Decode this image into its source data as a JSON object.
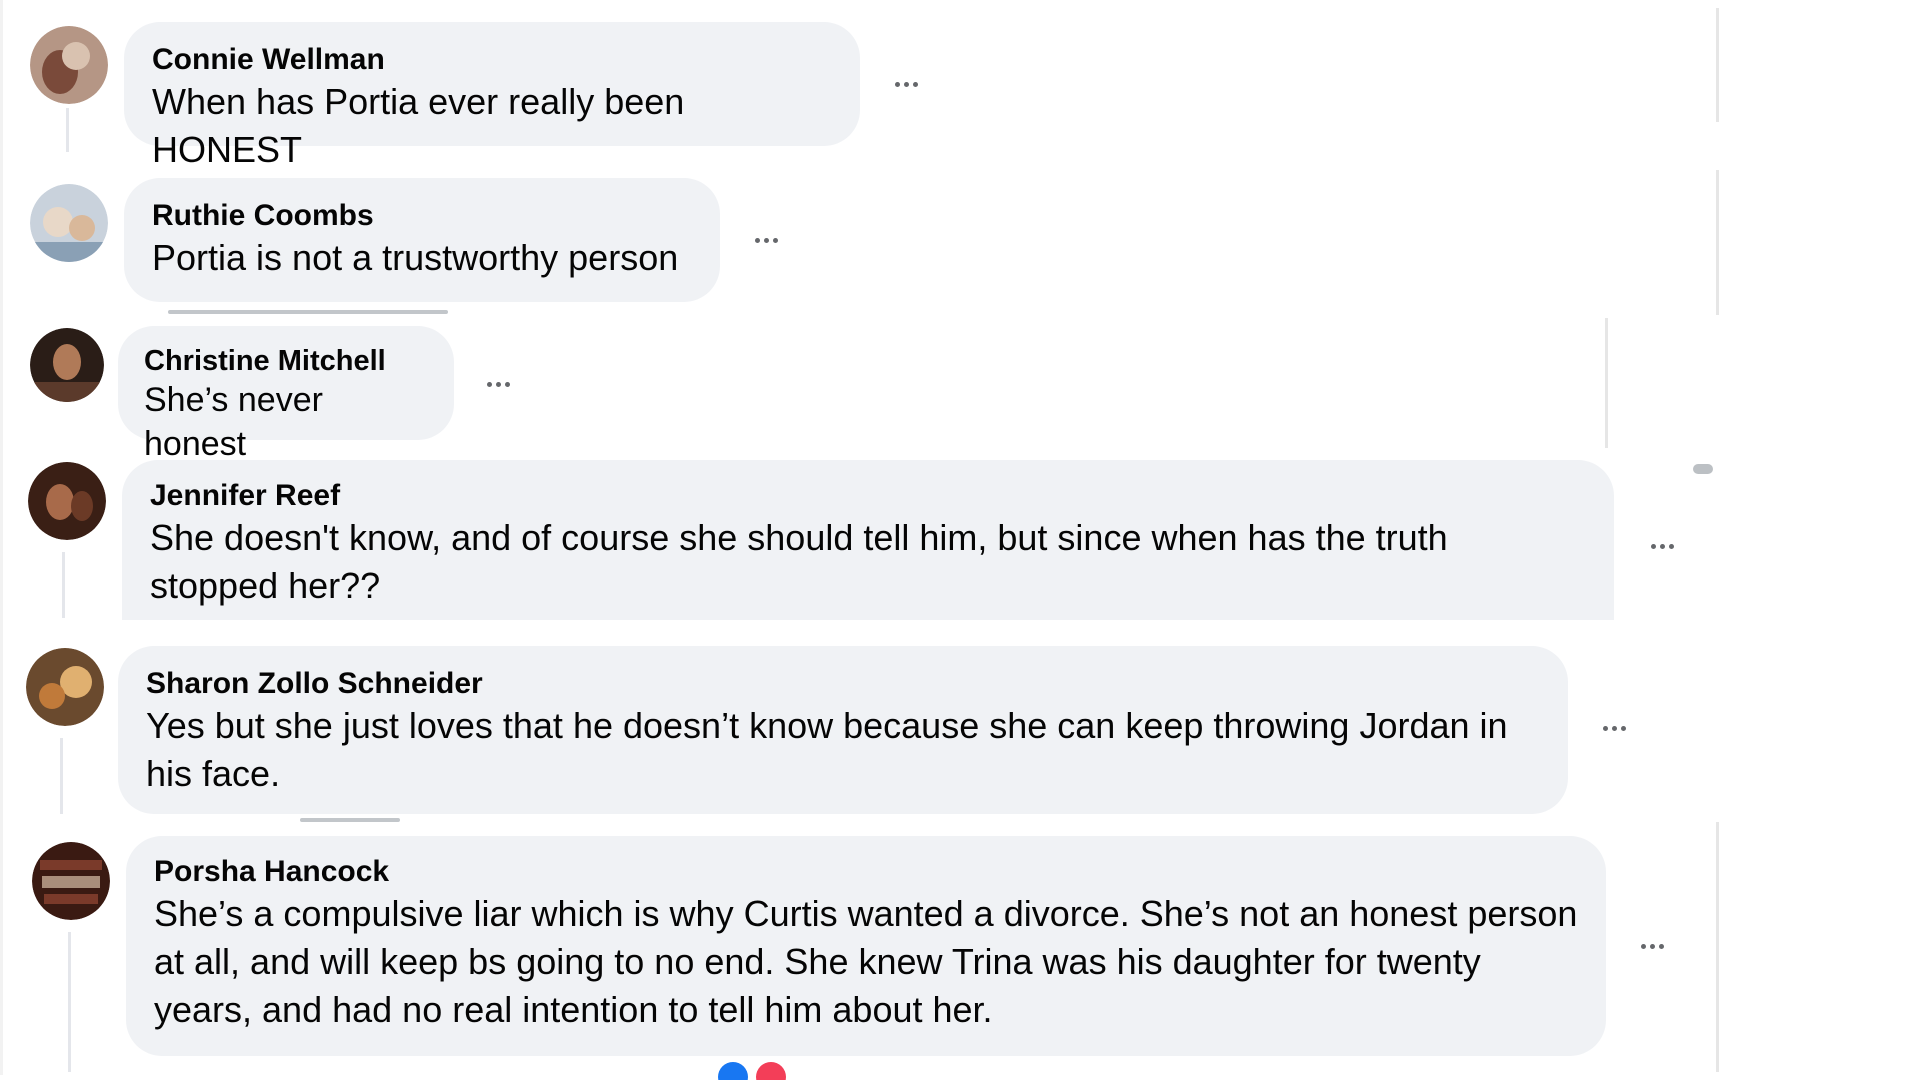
{
  "comments": [
    {
      "author": "Connie Wellman",
      "text": "When has Portia ever really been HONEST",
      "avatar_colors": [
        "#b59685",
        "#7a4a3a",
        "#d9c2b0"
      ]
    },
    {
      "author": "Ruthie Coombs",
      "text": "Portia is not a trustworthy person",
      "avatar_colors": [
        "#c9d2dc",
        "#8aa0b5",
        "#e8d8c8"
      ]
    },
    {
      "author": "Christine Mitchell",
      "text": "She’s never honest",
      "avatar_colors": [
        "#2a1d17",
        "#5b3a2b",
        "#b07a58"
      ]
    },
    {
      "author": "Jennifer Reef",
      "text": "She doesn't know, and of course she should tell him, but since when has the truth stopped her??",
      "avatar_colors": [
        "#3a1f15",
        "#6b3a26",
        "#a86a4a"
      ]
    },
    {
      "author": "Sharon Zollo Schneider",
      "text": "Yes but she just loves that he doesn’t know because she can keep throwing Jordan in his face.",
      "avatar_colors": [
        "#6a4a2e",
        "#c07a3a",
        "#e0b070"
      ]
    },
    {
      "author": "Porsha Hancock",
      "text": "She’s a compulsive liar which is why Curtis wanted a divorce. She’s not an honest person at all, and will keep bs going to no end. She knew Trina was his daughter for twenty years, and had no real intention to tell him about her.",
      "avatar_colors": [
        "#3a1a12",
        "#7a3a2a",
        "#d8c0a8"
      ]
    }
  ],
  "icons": {
    "more": "more-options-icon"
  },
  "colors": {
    "bubble": "#f0f2f5",
    "text": "#050505",
    "icon": "#65676b",
    "reaction_like": "#1877f2",
    "reaction_love": "#f33e58"
  }
}
